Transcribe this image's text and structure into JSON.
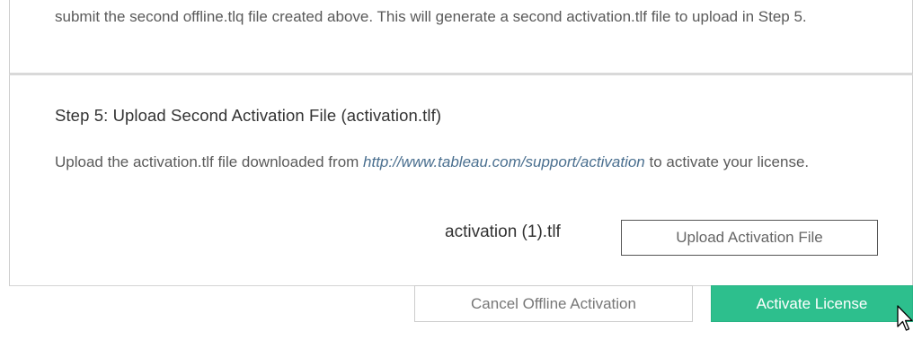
{
  "step4": {
    "description": "submit the second offline.tlq file created above. This will generate a second activation.tlf file to upload in Step 5."
  },
  "step5": {
    "title": "Step 5: Upload Second Activation File (activation.tlf)",
    "description_prefix": "Upload the activation.tlf file downloaded from ",
    "link_text": "http://www.tableau.com/support/activation",
    "description_suffix": " to activate your license.",
    "file_name": "activation (1).tlf",
    "upload_label": "Upload Activation File"
  },
  "footer": {
    "cancel_label": "Cancel Offline Activation",
    "activate_label": "Activate License"
  },
  "colors": {
    "accent": "#2dbf8d",
    "link": "#4a6f8f"
  },
  "icons": {
    "pointer": "mouse-pointer-icon"
  }
}
